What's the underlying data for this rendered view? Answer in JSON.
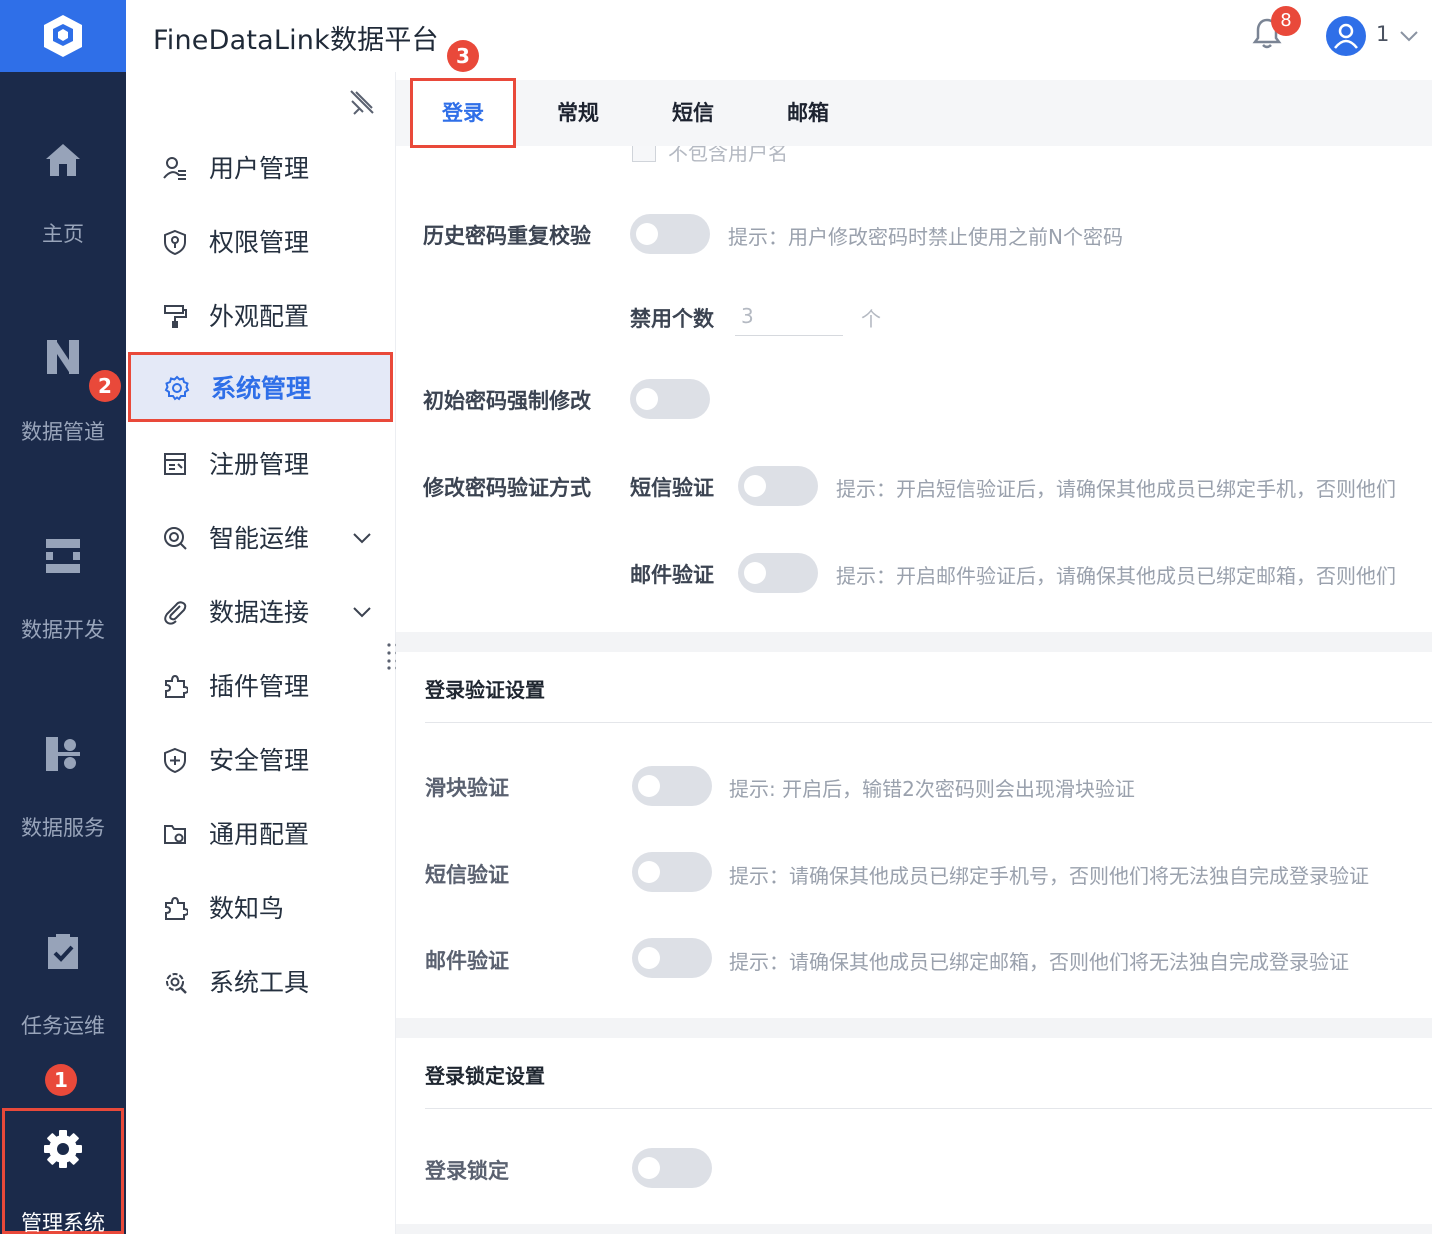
{
  "app": {
    "title": "FineDataLink数据平台"
  },
  "header": {
    "notification_count": "8",
    "user_name": "1"
  },
  "rail": {
    "items": [
      {
        "label": "主页",
        "icon": "home-icon"
      },
      {
        "label": "数据管道",
        "icon": "pipeline-icon"
      },
      {
        "label": "数据开发",
        "icon": "data-dev-icon"
      },
      {
        "label": "数据服务",
        "icon": "data-service-icon"
      },
      {
        "label": "任务运维",
        "icon": "task-ops-icon"
      },
      {
        "label": "管理系统",
        "icon": "gear-icon",
        "active": true
      }
    ]
  },
  "sidebar": {
    "items": [
      {
        "label": "用户管理",
        "icon": "user-manage-icon"
      },
      {
        "label": "权限管理",
        "icon": "permission-icon"
      },
      {
        "label": "外观配置",
        "icon": "paint-roller-icon"
      },
      {
        "label": "系统管理",
        "icon": "gear-outline-icon",
        "active": true
      },
      {
        "label": "注册管理",
        "icon": "register-icon"
      },
      {
        "label": "智能运维",
        "icon": "smart-ops-icon",
        "expandable": true
      },
      {
        "label": "数据连接",
        "icon": "paperclip-icon",
        "expandable": true
      },
      {
        "label": "插件管理",
        "icon": "puzzle-icon"
      },
      {
        "label": "安全管理",
        "icon": "shield-plus-icon"
      },
      {
        "label": "通用配置",
        "icon": "folder-gear-icon"
      },
      {
        "label": "数知鸟",
        "icon": "puzzle-icon"
      },
      {
        "label": "系统工具",
        "icon": "gear-tool-icon"
      }
    ]
  },
  "tabs": [
    {
      "label": "登录",
      "active": true
    },
    {
      "label": "常规"
    },
    {
      "label": "短信"
    },
    {
      "label": "邮箱"
    }
  ],
  "password": {
    "cut_text": "不包含用户名",
    "history_label": "历史密码重复校验",
    "history_hint": "提示：用户修改密码时禁止使用之前N个密码",
    "ban_count_label": "禁用个数",
    "ban_count_value": "3",
    "ban_count_unit": "个",
    "force_change_label": "初始密码强制修改",
    "verify_method_label": "修改密码验证方式",
    "sms_label": "短信验证",
    "sms_hint": "提示：开启短信验证后，请确保其他成员已绑定手机，否则他们",
    "mail_label": "邮件验证",
    "mail_hint": "提示：开启邮件验证后，请确保其他成员已绑定邮箱，否则他们"
  },
  "login_verify": {
    "title": "登录验证设置",
    "slider_label": "滑块验证",
    "slider_hint": "提示: 开启后，输错2次密码则会出现滑块验证",
    "sms_label": "短信验证",
    "sms_hint": "提示：请确保其他成员已绑定手机号，否则他们将无法独自完成登录验证",
    "mail_label": "邮件验证",
    "mail_hint": "提示：请确保其他成员已绑定邮箱，否则他们将无法独自完成登录验证"
  },
  "login_lock": {
    "title": "登录锁定设置",
    "lock_label": "登录锁定"
  },
  "steps": [
    "1",
    "2",
    "3"
  ],
  "colors": {
    "accent": "#2f6fe8",
    "rail": "#1b2a4a",
    "highlight": "#e9493a"
  }
}
